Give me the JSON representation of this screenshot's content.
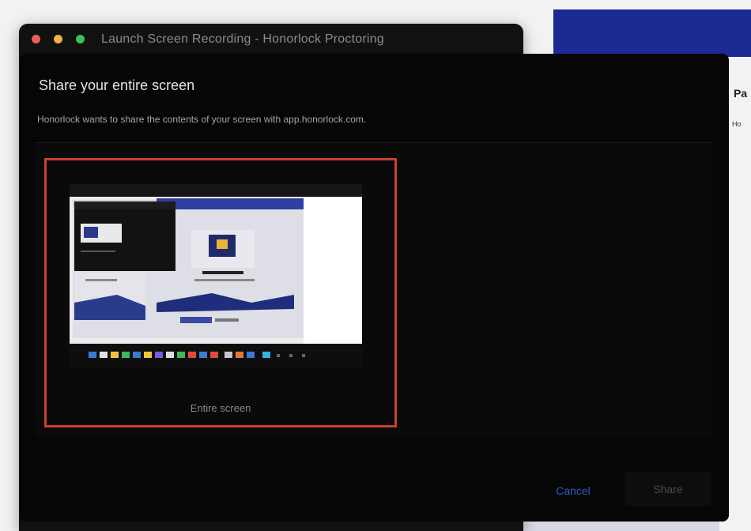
{
  "window": {
    "title": "Launch Screen Recording - Honorlock Proctoring"
  },
  "dialog": {
    "title": "Share your entire screen",
    "description": "Honorlock wants to share the contents of your screen with app.honorlock.com.",
    "tiles": [
      {
        "label": "Entire screen",
        "selected": true
      }
    ],
    "cancel_label": "Cancel",
    "share_label": "Share"
  },
  "background_page": {
    "heading": "Pa",
    "subtext": "Ho"
  },
  "colors": {
    "selection_border": "#c8412c",
    "dialog_bg": "#060606",
    "cancel_text": "#2f5fc4",
    "banner": "#1d2a94"
  }
}
